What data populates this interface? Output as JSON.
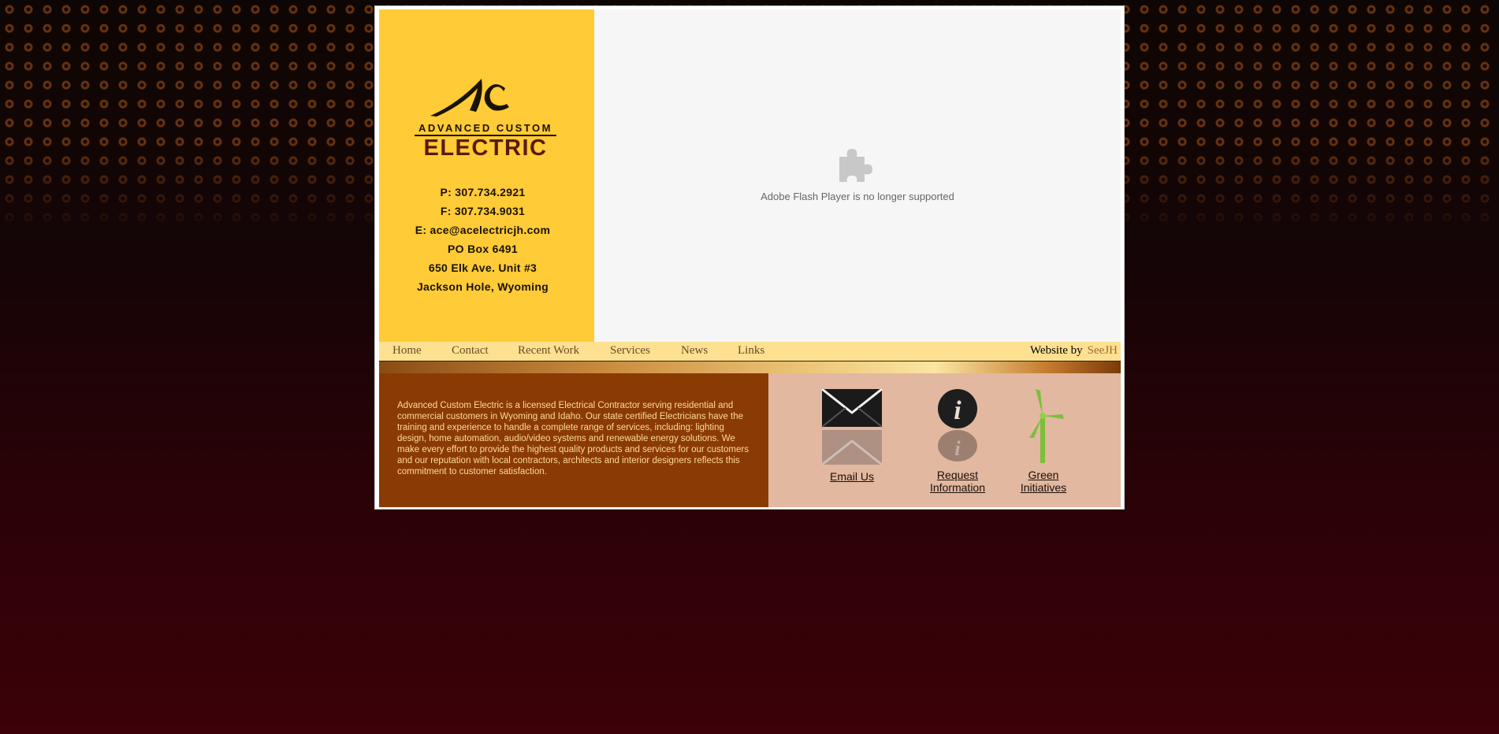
{
  "contact": {
    "phone": "P: 307.734.2921",
    "fax": "F: 307.734.9031",
    "email": "E: ace@acelectricjh.com",
    "po_box": "PO Box 6491",
    "address": "650 Elk Ave. Unit #3",
    "city": "Jackson Hole, Wyoming"
  },
  "logo": {
    "monogram": "AC",
    "line1": "ADVANCED CUSTOM",
    "line2": "ELECTRIC"
  },
  "flash": {
    "message": "Adobe Flash Player is no longer supported",
    "icon": "puzzle-icon"
  },
  "nav": {
    "items": [
      "Home",
      "Contact",
      "Recent Work",
      "Services",
      "News",
      "Links"
    ],
    "credit_prefix": "Website by",
    "credit_link": "SeeJH"
  },
  "about": {
    "text": "Advanced Custom Electric is a licensed Electrical Contractor serving residential and commercial customers in Wyoming and Idaho. Our state certified Electricians have the training and experience to handle a complete range of services, including: lighting design, home automation, audio/video systems and renewable energy solutions. We make every effort to provide the highest quality products and services for our customers and our reputation with local contractors, architects and interior designers reflects this commitment to customer satisfaction."
  },
  "actions": {
    "email": "Email Us",
    "request_line1": "Request",
    "request_line2": "Information",
    "green_line1": "Green",
    "green_line2": "Initiatives"
  },
  "colors": {
    "sidebar": "#ffcb36",
    "about_bg": "#8a3b03",
    "icons_bg": "#e2b8a0",
    "nav_bg": "#fde190"
  }
}
